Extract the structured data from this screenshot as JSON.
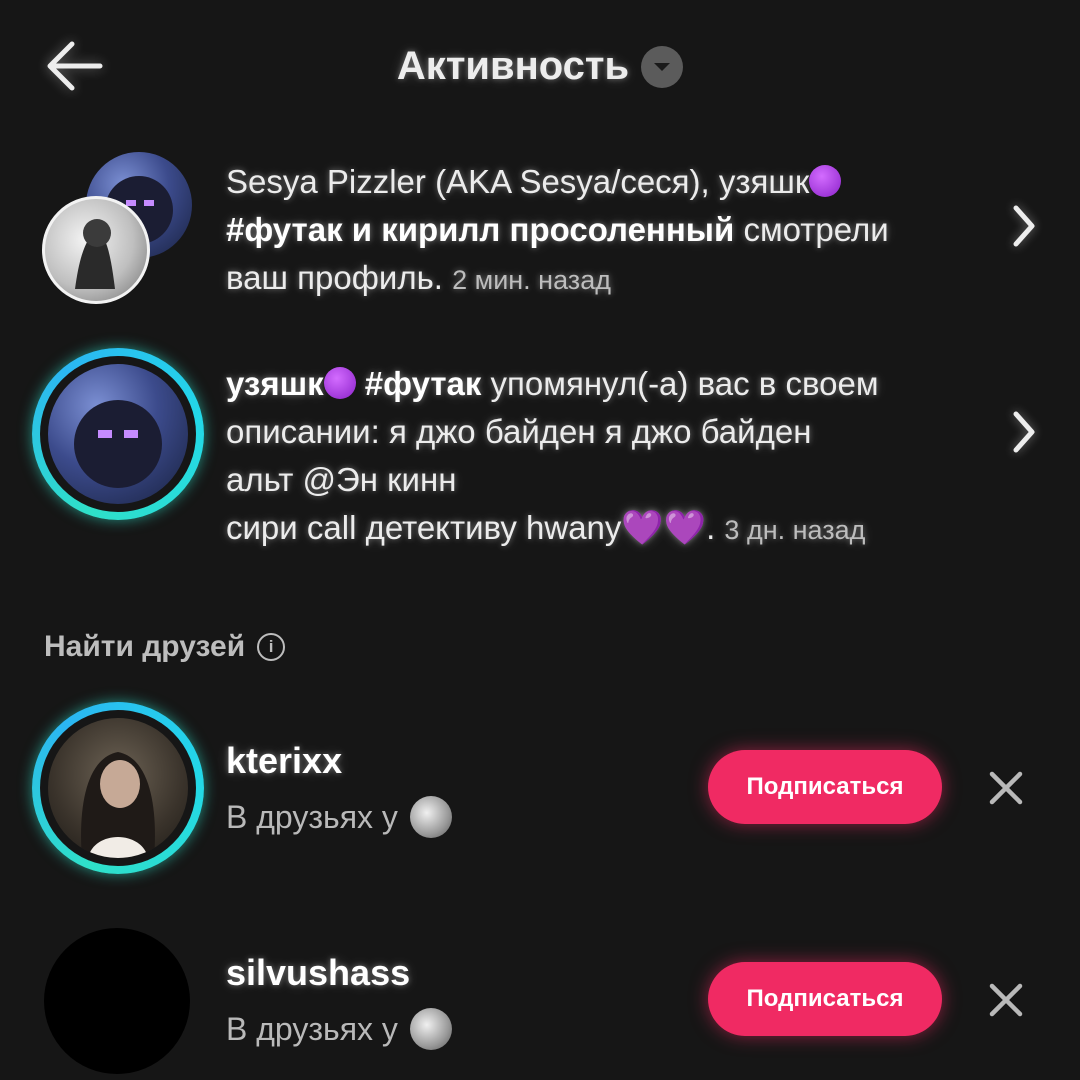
{
  "header": {
    "title": "Активность",
    "back_icon": "arrow-left-icon",
    "caret_icon": "chevron-down-icon"
  },
  "activity": [
    {
      "actors": "Sesya Pizzler (AKA Sesya/сеся), узяшк",
      "actors_2": "#футак и кирилл просоленный",
      "text": "смотрели ваш профиль.",
      "time": "2 мин. назад"
    },
    {
      "actor": "узяшк",
      "actor_2": "#футак",
      "line1_rest": "упомянул(-а) вас в своем",
      "line2": "описании: я джо байден я джо байден",
      "line3": "альт @Эн кинн",
      "line4": "сири call детективу hwany",
      "hearts": "💜💜",
      "dot": ".",
      "time": "3 дн. назад"
    }
  ],
  "find_friends": {
    "title": "Найти друзей",
    "info_icon": "info-icon",
    "friends": [
      {
        "username": "kterixx",
        "subtitle": "В друзьях у",
        "button": "Подписаться"
      },
      {
        "username": "silvushass",
        "subtitle": "В друзьях у",
        "button": "Подписаться"
      }
    ]
  },
  "colors": {
    "background": "#161616",
    "follow_button": "#f02a63",
    "story_ring": "#2fe0c8"
  }
}
